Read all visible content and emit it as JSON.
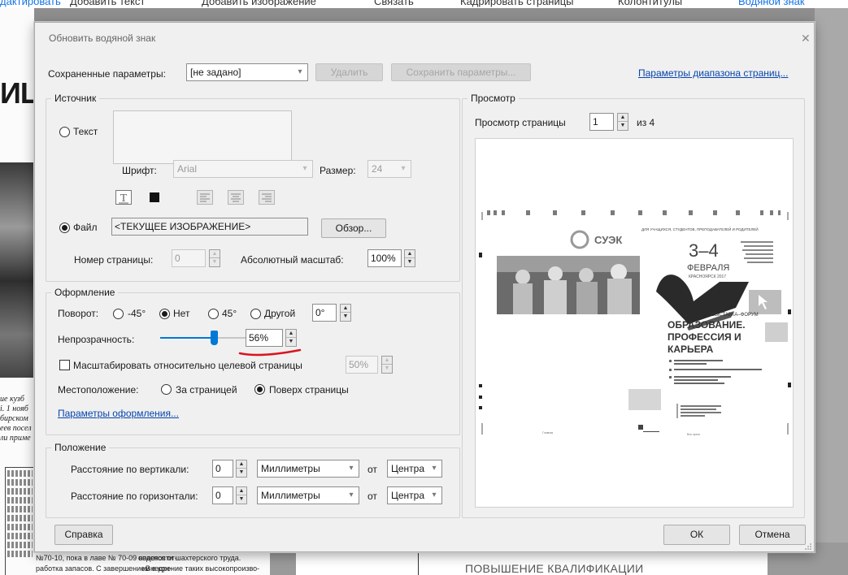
{
  "app_toolbar": {
    "items": [
      "дактировать",
      "Добавить текст",
      "Добавить изображение",
      "Связать",
      "Кадрировать страницы",
      "Колонтитулы",
      "Водяной знак"
    ]
  },
  "background": {
    "heading_fragment": "ИЦ",
    "para_lines": [
      "ие кузб",
      "і. 1 нояб",
      "бирском",
      "еев посел",
      "ли приме"
    ],
    "bottom_left_lines": [
      "№70-10, пока в лаве № 70-09 ведется от-",
      "работка запасов. С завершением в кон-",
      "опасности шахтерского труда.",
      "«Внедрение таких высокопроизво-"
    ],
    "bottom_right_caption": "ПОВЫШЕНИЕ КВАЛИФИКАЦИИ"
  },
  "dialog": {
    "title": "Обновить водяной знак",
    "saved_params_label": "Сохраненные параметры:",
    "saved_params_value": "[не задано]",
    "delete_label": "Удалить",
    "save_params_label": "Сохранить параметры...",
    "page_range_link": "Параметры диапазона страниц...",
    "source": {
      "title": "Источник",
      "text_label": "Текст",
      "font_label": "Шрифт:",
      "font_value": "Arial",
      "size_label": "Размер:",
      "size_value": "24",
      "file_label": "Файл",
      "file_value": "<ТЕКУЩЕЕ ИЗОБРАЖЕНИЕ>",
      "browse_label": "Обзор...",
      "page_number_label": "Номер страницы:",
      "page_number_value": "0",
      "abs_scale_label": "Абсолютный масштаб:",
      "abs_scale_value": "100%"
    },
    "appearance": {
      "title": "Оформление",
      "rotation_label": "Поворот:",
      "rot_m45": "-45°",
      "rot_none": "Нет",
      "rot_45": "45°",
      "rot_other": "Другой",
      "rot_value": "0°",
      "opacity_label": "Непрозрачность:",
      "opacity_value": "56%",
      "opacity_fraction": 0.56,
      "scale_rel_label": "Масштабировать относительно целевой страницы",
      "scale_rel_value": "50%",
      "location_label": "Местоположение:",
      "behind_label": "За страницей",
      "front_label": "Поверх страницы",
      "appearance_options_link": "Параметры оформления..."
    },
    "position": {
      "title": "Положение",
      "vertical_label": "Расстояние по вертикали:",
      "vertical_value": "0",
      "vertical_units": "Миллиметры",
      "from_label": "от",
      "vertical_anchor": "Центра",
      "horizontal_label": "Расстояние по горизонтали:",
      "horizontal_value": "0",
      "horizontal_units": "Миллиметры",
      "horizontal_anchor": "Центра"
    },
    "preview": {
      "title": "Просмотр",
      "page_label": "Просмотр страницы",
      "page_value": "1",
      "of_label": "из 4",
      "poster": {
        "logo_text": "СУЭК",
        "top_line": "ДЛЯ УЧАЩИХСЯ, СТУДЕНТОВ, ПРЕПОДАВАТЕЛЕЙ И РОДИТЕЛЕЙ",
        "date": "3–4",
        "month": "ФЕВРАЛЯ",
        "city_year": "КРАСНОЯРСК 2017",
        "forum": "ВЫСТАВКА–ФОРУМ",
        "headline_1": "ОБРАЗОВАНИЕ.",
        "headline_2": "ПРОФЕССИЯ И",
        "headline_3": "КАРЬЕРА",
        "footer_left": "Главная",
        "footer_right": "Все пресс"
      }
    },
    "help_label": "Справка",
    "ok_label": "ОК",
    "cancel_label": "Отмена"
  },
  "colors": {
    "accent": "#0078d7",
    "link": "#0645ad",
    "annotation": "#d9141e",
    "dialog_bg": "#f0f0f0"
  }
}
